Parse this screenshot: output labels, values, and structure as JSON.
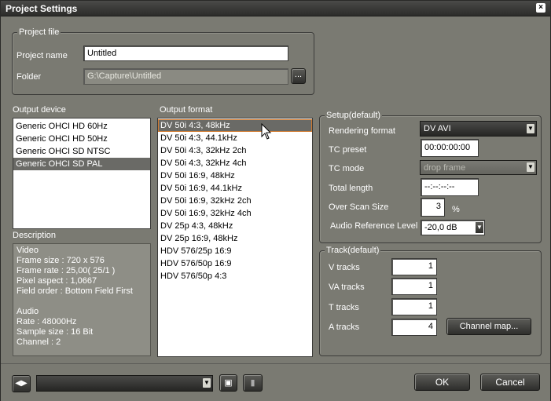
{
  "window": {
    "title": "Project Settings",
    "close_label": "×"
  },
  "project_file": {
    "group_title": "Project file",
    "name_label": "Project name",
    "name_value": "Untitled",
    "folder_label": "Folder",
    "folder_value": "G:\\Capture\\Untitled",
    "browse_label": "..."
  },
  "output_device": {
    "label": "Output device",
    "items": [
      "Generic OHCI HD 60Hz",
      "Generic OHCI HD 50Hz",
      "Generic OHCI SD NTSC",
      "Generic OHCI SD PAL"
    ],
    "selected": "Generic OHCI SD PAL"
  },
  "output_format": {
    "label": "Output format",
    "items": [
      "DV 50i 4:3, 48kHz",
      "DV 50i 4:3, 44.1kHz",
      "DV 50i 4:3, 32kHz 2ch",
      "DV 50i 4:3, 32kHz 4ch",
      "DV 50i 16:9, 48kHz",
      "DV 50i 16:9, 44.1kHz",
      "DV 50i 16:9, 32kHz 2ch",
      "DV 50i 16:9, 32kHz 4ch",
      "DV 25p 4:3, 48kHz",
      "DV 25p 16:9, 48kHz",
      "HDV 576/25p 16:9",
      "HDV 576/50p 16:9",
      "HDV 576/50p 4:3"
    ],
    "selected": "DV 50i 4:3, 48kHz"
  },
  "description": {
    "label": "Description",
    "lines": [
      "Video",
      " Frame size : 720 x 576",
      " Frame rate : 25,00( 25/1 )",
      " Pixel aspect : 1,0667",
      " Field order : Bottom Field First",
      "",
      "Audio",
      " Rate : 48000Hz",
      " Sample size : 16 Bit",
      " Channel : 2"
    ]
  },
  "setup": {
    "group_title": "Setup(default)",
    "rendering_format_label": "Rendering format",
    "rendering_format_value": "DV AVI",
    "tc_preset_label": "TC preset",
    "tc_preset_value": "00:00:00:00",
    "tc_mode_label": "TC mode",
    "tc_mode_value": "drop frame",
    "total_length_label": "Total length",
    "total_length_value": "--:--:--:--",
    "over_scan_label": "Over Scan Size",
    "over_scan_value": "3",
    "over_scan_unit": "%",
    "audio_ref_label": "Audio Reference Level",
    "audio_ref_value": "-20,0 dB"
  },
  "track": {
    "group_title": "Track(default)",
    "v_label": "V tracks",
    "v_value": "1",
    "va_label": "VA tracks",
    "va_value": "1",
    "t_label": "T tracks",
    "t_value": "1",
    "a_label": "A tracks",
    "a_value": "4",
    "channel_map_label": "Channel map..."
  },
  "bottom": {
    "preset_value": "",
    "ok_label": "OK",
    "cancel_label": "Cancel"
  },
  "colors": {
    "dialog_bg": "#7a7a72",
    "selection": "#6a6a66",
    "focus_outline": "#d07a30"
  }
}
